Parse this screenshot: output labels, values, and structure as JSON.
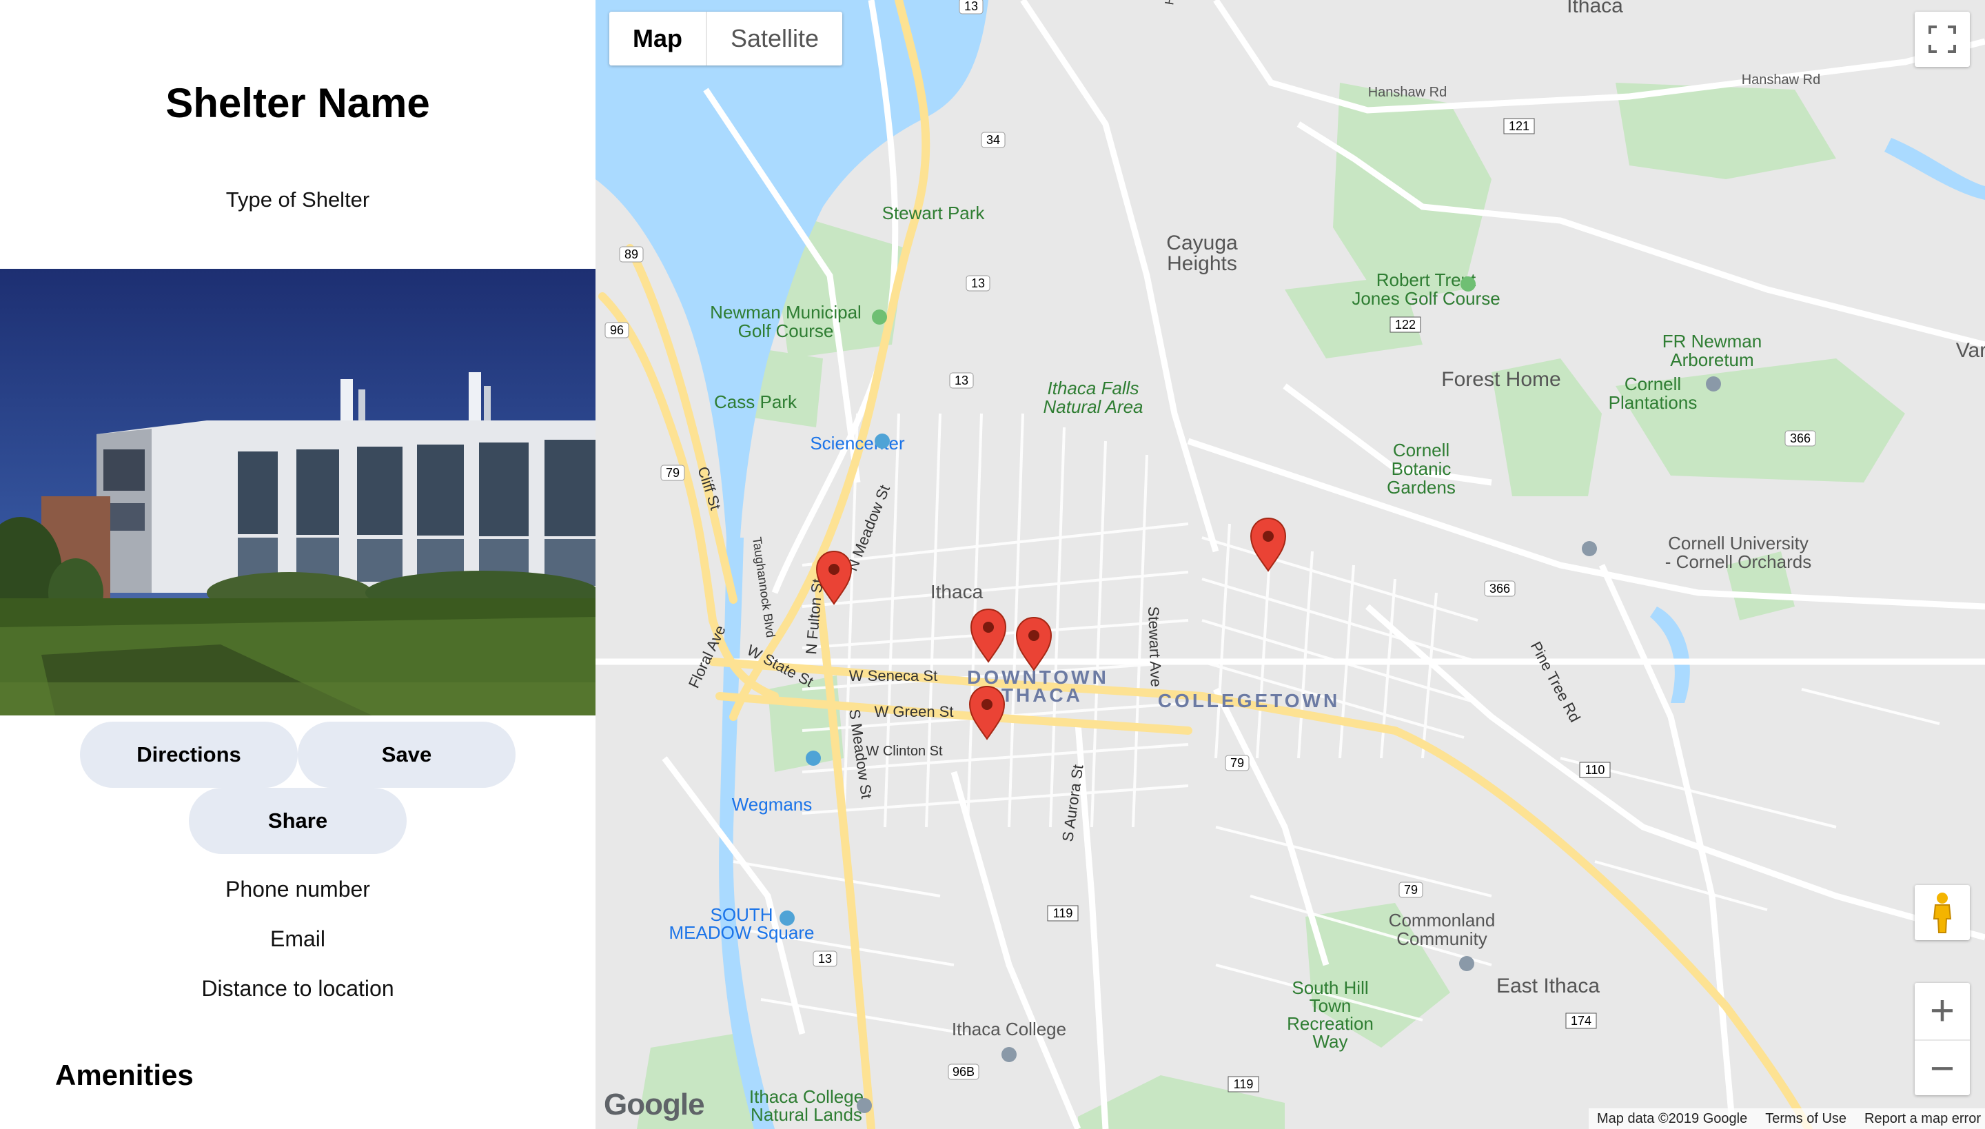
{
  "shelter": {
    "name": "Shelter Name",
    "type": "Type of Shelter",
    "phone": "Phone number",
    "email": "Email",
    "distance": "Distance to location",
    "amenities_heading": "Amenities"
  },
  "actions": {
    "directions_label": "Directions",
    "save_label": "Save",
    "share_label": "Share"
  },
  "map": {
    "type_map_label": "Map",
    "type_satellite_label": "Satellite",
    "active_type": "Map",
    "labels": {
      "ithaca_top": "Ithaca",
      "hanshaw_rd_1": "Hanshaw Rd",
      "hanshaw_rd_2": "Hanshaw Rd",
      "stewart_park": "Stewart Park",
      "cayuga_1": "Cayuga",
      "cayuga_2": "Heights",
      "robert_trent_1": "Robert Trent",
      "robert_trent_2": "Jones Golf Course",
      "newman_1": "Newman Municipal",
      "newman_2": "Golf Course",
      "fr_newman_1": "FR Newman",
      "fr_newman_2": "Arboretum",
      "forest_home": "Forest Home",
      "cornell_plant_1": "Cornell",
      "cornell_plant_2": "Plantations",
      "ithaca_falls_1": "Ithaca Falls",
      "ithaca_falls_2": "Natural Area",
      "cass_park": "Cass Park",
      "sciencenter": "Sciencenter",
      "cornell_botanic_1": "Cornell",
      "cornell_botanic_2": "Botanic",
      "cornell_botanic_3": "Gardens",
      "cornell_univ_1": "Cornell University",
      "cornell_univ_2": "- Cornell Orchards",
      "ithaca_center": "Ithaca",
      "downtown_1": "DOWNTOWN",
      "downtown_2": "ITHACA",
      "collegetown": "COLLEGETOWN",
      "w_seneca": "W Seneca St",
      "w_green": "W Green St",
      "w_clinton": "W Clinton St",
      "w_state": "W State St",
      "cliff_st": "Cliff St",
      "taughannock": "Taughannock Blvd",
      "n_fulton": "N Fulton St",
      "meadow_st": "N Meadow St",
      "s_meadow": "S Meadow St",
      "s_aurora": "S Aurora St",
      "stewart_ave": "Stewart Ave",
      "pine_tree": "Pine Tree Rd",
      "floral_ave": "Floral Ave",
      "wegmans": "Wegmans",
      "south_meadow_1": "SOUTH",
      "south_meadow_2": "MEADOW Square",
      "commonland_1": "Commonland",
      "commonland_2": "Community",
      "east_ithaca": "East Ithaca",
      "south_hill_1": "South Hill",
      "south_hill_2": "Town",
      "south_hill_3": "Recreation",
      "south_hill_4": "Way",
      "ithaca_college": "Ithaca College",
      "ic_natural_1": "Ithaca College",
      "ic_natural_2": "Natural Lands",
      "var_edge": "Var",
      "hwy_13_a": "13",
      "hwy_13_b": "13",
      "hwy_13_c": "13",
      "hwy_13_d": "13",
      "hwy_34": "34",
      "hwy_89": "89",
      "hwy_96": "96",
      "hwy_96b": "96B",
      "hwy_79_a": "79",
      "hwy_79_b": "79",
      "hwy_79_c": "79",
      "hwy_121": "121",
      "hwy_122": "122",
      "hwy_366_a": "366",
      "hwy_366_b": "366",
      "hwy_110": "110",
      "hwy_119_a": "119",
      "hwy_119_b": "119",
      "hwy_174": "174",
      "harshaw": "Harsha"
    },
    "footer": {
      "map_data": "Map data ©2019 Google",
      "terms": "Terms of Use",
      "report": "Report a map error"
    },
    "zoom_in": "+",
    "zoom_out": "−",
    "google_logo": "Google",
    "colors": {
      "water": "#aadaff",
      "park": "#c8e6c3",
      "road": "#ffffff",
      "highway": "#fde293",
      "marker": "#ea4335",
      "button_bg": "#e5eaf3"
    }
  }
}
